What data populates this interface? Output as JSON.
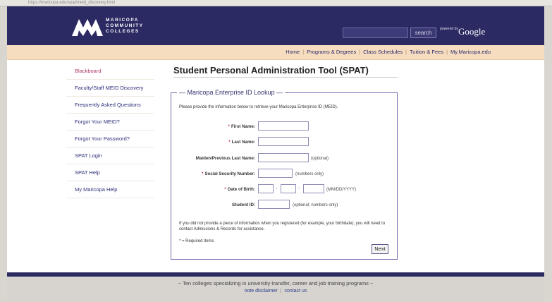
{
  "browser": {
    "url": "https://maricopa.edu/spat/meid_discovery.html"
  },
  "header": {
    "logo_lines": [
      "MARICOPA",
      "COMMUNITY",
      "COLLEGES"
    ],
    "search_placeholder": "",
    "search_button": "search",
    "powered_by": "powered by",
    "google": "Google"
  },
  "nav": {
    "links": [
      "Home",
      "Programs & Degrees",
      "Class Schedules",
      "Tuition & Fees",
      "My.Maricopa.edu"
    ]
  },
  "sidebar": {
    "items": [
      {
        "label": "Blackboard"
      },
      {
        "label": "Faculty/Staff MEID Discovery"
      },
      {
        "label": "Frequently Asked Questions"
      },
      {
        "label": "Forgot Your MEID?"
      },
      {
        "label": "Forgot Your Password?"
      },
      {
        "label": "SPAT Login"
      },
      {
        "label": "SPAT Help"
      },
      {
        "label": "My Maricopa Help"
      }
    ]
  },
  "main": {
    "title": "Student Personal Administration Tool (SPAT)",
    "legend": "Maricopa Enterprise ID Lookup",
    "intro": "Please provide the information below to retrieve your Maricopa Enterprise ID (MEID).",
    "fields": {
      "first_name": {
        "label": "First Name:",
        "required": "*"
      },
      "last_name": {
        "label": "Last Name:",
        "required": "*"
      },
      "maiden_name": {
        "label": "Maiden/Previous Last Name:",
        "hint": "(optional)"
      },
      "ssn": {
        "label": "Social Security Number:",
        "required": "*",
        "hint": "(numbers only)"
      },
      "dob": {
        "label": "Date of Birth:",
        "required": "*",
        "hint": "(MM/DD/YYYY)",
        "separator": "-"
      },
      "student_id": {
        "label": "Student ID:",
        "hint": "(optional; numbers only)"
      }
    },
    "note": "If you did not provide a piece of information when you registered (for example, your birthdate), you will need to contact Admissions & Records for assistance.",
    "required_note": "* = Required items",
    "next_button": "Next"
  },
  "footer": {
    "tagline": "~ Ten colleges specializing in university transfer, career and job training programs ~",
    "links": [
      "note disclaimer",
      "contact us"
    ]
  },
  "colors": {
    "header_bg": "#2b2a63",
    "nav_bg": "#f7ddbf",
    "link": "#2d2d7a",
    "active_link": "#b03a6a",
    "fieldset_border": "#6d6db0"
  }
}
